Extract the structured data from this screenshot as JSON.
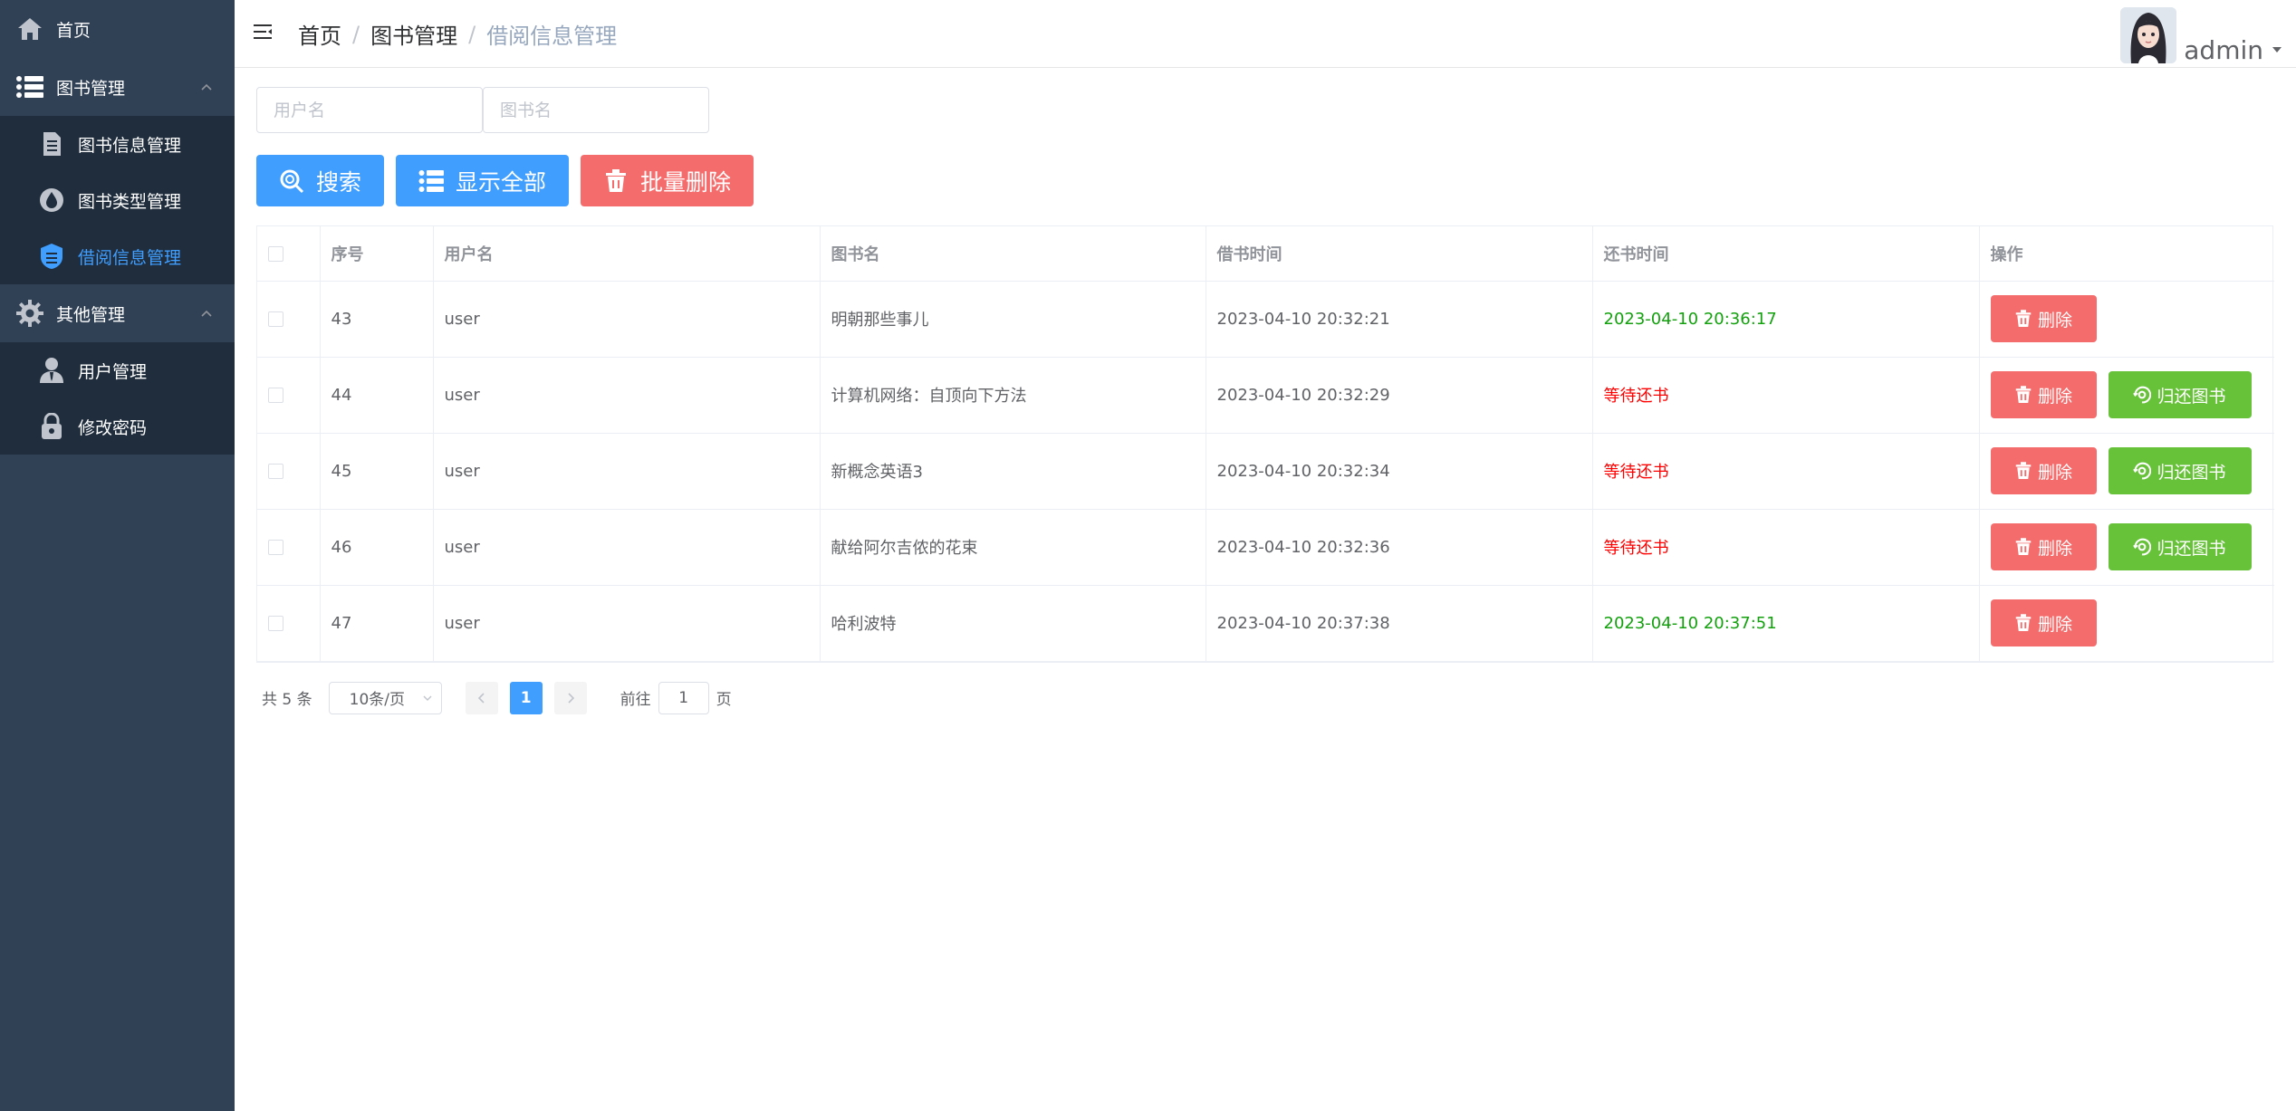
{
  "sidebar": {
    "home_label": "首页",
    "groups": [
      {
        "label": "图书管理",
        "items": [
          {
            "label": "图书信息管理"
          },
          {
            "label": "图书类型管理"
          },
          {
            "label": "借阅信息管理"
          }
        ]
      },
      {
        "label": "其他管理",
        "items": [
          {
            "label": "用户管理"
          },
          {
            "label": "修改密码"
          }
        ]
      }
    ],
    "active_item": "借阅信息管理"
  },
  "header": {
    "breadcrumb": [
      "首页",
      "图书管理",
      "借阅信息管理"
    ],
    "separator": "/",
    "username": "admin"
  },
  "search": {
    "username_placeholder": "用户名",
    "bookname_placeholder": "图书名"
  },
  "toolbar": {
    "search_label": "搜索",
    "show_all_label": "显示全部",
    "batch_delete_label": "批量删除"
  },
  "table": {
    "columns": [
      "序号",
      "用户名",
      "图书名",
      "借书时间",
      "还书时间",
      "操作"
    ],
    "delete_label": "删除",
    "return_label": "归还图书",
    "rows": [
      {
        "id": "43",
        "user": "user",
        "book": "明朝那些事儿",
        "borrow_time": "2023-04-10 20:32:21",
        "return_time": "2023-04-10 20:36:17",
        "returned": true
      },
      {
        "id": "44",
        "user": "user",
        "book": "计算机网络：自顶向下方法",
        "borrow_time": "2023-04-10 20:32:29",
        "return_time": "等待还书",
        "returned": false
      },
      {
        "id": "45",
        "user": "user",
        "book": "新概念英语3",
        "borrow_time": "2023-04-10 20:32:34",
        "return_time": "等待还书",
        "returned": false
      },
      {
        "id": "46",
        "user": "user",
        "book": "献给阿尔吉侬的花束",
        "borrow_time": "2023-04-10 20:32:36",
        "return_time": "等待还书",
        "returned": false
      },
      {
        "id": "47",
        "user": "user",
        "book": "哈利波特",
        "borrow_time": "2023-04-10 20:37:38",
        "return_time": "2023-04-10 20:37:51",
        "returned": true
      }
    ]
  },
  "pagination": {
    "total_text": "共 5 条",
    "page_size_label": "10条/页",
    "current_page": "1",
    "prev_icon": "chevron-left-icon",
    "next_icon": "chevron-right-icon",
    "jump_prefix": "前往",
    "jump_value": "1",
    "jump_suffix": "页"
  },
  "colors": {
    "sidebar_bg": "#304156",
    "submenu_bg": "#1f2d3d",
    "active": "#409eff",
    "danger": "#f56c6c",
    "success_button": "#67c23a",
    "returned_text": "#13a10e",
    "waiting_text": "#ff0000"
  }
}
